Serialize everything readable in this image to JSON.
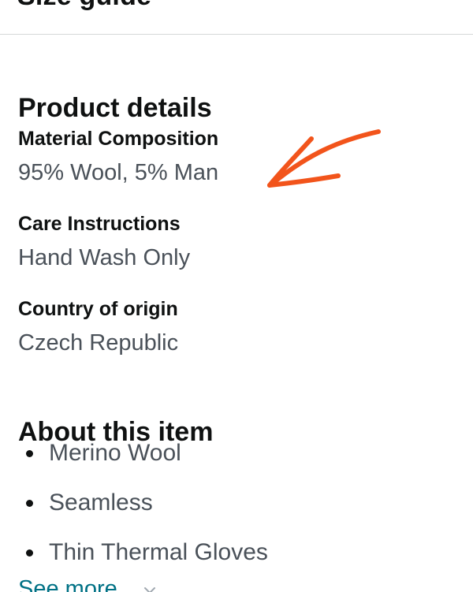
{
  "header": {
    "title": "Size guide"
  },
  "product_details": {
    "title": "Product details",
    "items": [
      {
        "label": "Material Composition",
        "value": "95% Wool, 5% Man"
      },
      {
        "label": "Care Instructions",
        "value": "Hand Wash Only"
      },
      {
        "label": "Country of origin",
        "value": "Czech Republic"
      }
    ]
  },
  "about": {
    "title": "About this item",
    "bullets": [
      "Merino Wool",
      "Seamless",
      "Thin Thermal Gloves"
    ],
    "see_more_label": "See more"
  },
  "colors": {
    "text": "#0f1111",
    "muted": "#4a5159",
    "link": "#007185",
    "divider": "#d5d9d9",
    "annotation": "#f2541b"
  },
  "icons": {
    "see_more": "chevron-down-icon",
    "annotation": "hand-drawn-arrow-icon"
  }
}
